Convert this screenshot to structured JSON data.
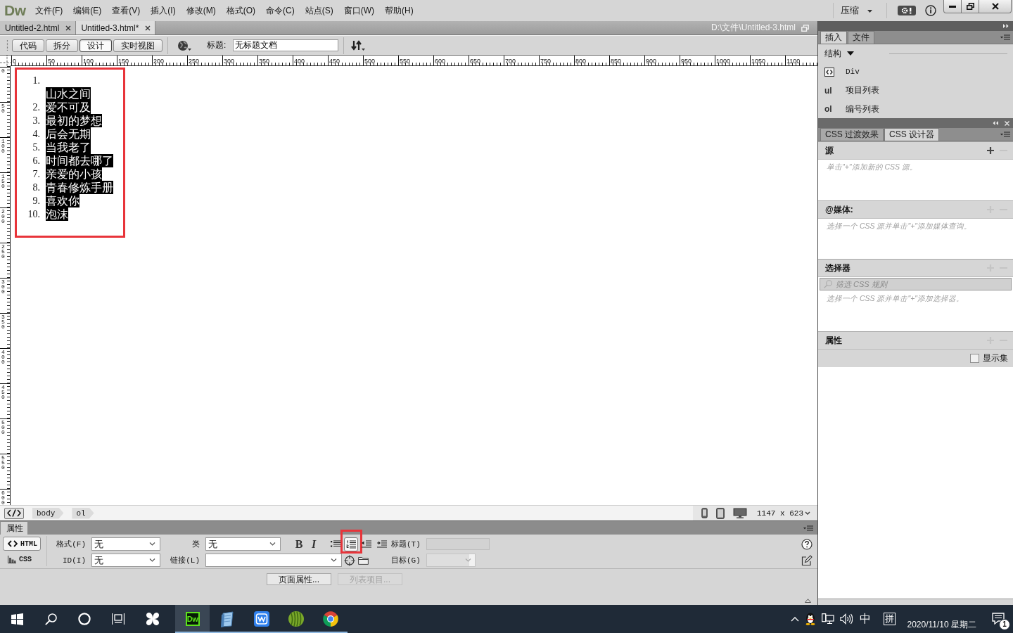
{
  "menu_bar": {
    "logo": "Dw",
    "menus": [
      "文件(F)",
      "编辑(E)",
      "查看(V)",
      "插入(I)",
      "修改(M)",
      "格式(O)",
      "命令(C)",
      "站点(S)",
      "窗口(W)",
      "帮助(H)"
    ],
    "workspace": "压缩"
  },
  "document_tabs": [
    {
      "label": "Untitled-2.html",
      "selected": false
    },
    {
      "label": "Untitled-3.html*",
      "selected": true
    }
  ],
  "file_path": "D:\\文件\\Untitled-3.html",
  "document_toolbar": {
    "views": [
      {
        "label": "代码",
        "selected": false
      },
      {
        "label": "拆分",
        "selected": false
      },
      {
        "label": "设计",
        "selected": true
      },
      {
        "label": "实时视图",
        "selected": false
      }
    ],
    "title_label": "标题:",
    "title_value": "无标题文档"
  },
  "rulers": {
    "horizontal": [
      "0",
      "50",
      "100",
      "150",
      "200",
      "250",
      "300",
      "350",
      "400",
      "450",
      "500",
      "550",
      "600",
      "650",
      "700",
      "750",
      "800",
      "850",
      "900",
      "950",
      "1000",
      "1050",
      "1100"
    ],
    "vertical": [
      "0",
      "50",
      "100",
      "150",
      "200",
      "250",
      "300",
      "350",
      "400",
      "450",
      "500",
      "550",
      "600"
    ]
  },
  "design_view": {
    "list_selected": true,
    "highlight_frame": true,
    "items": [
      {
        "number": "1.",
        "text": "山水之间",
        "break_before": true
      },
      {
        "number": "2.",
        "text": "爱不可及",
        "break_before": false
      },
      {
        "number": "3.",
        "text": "最初的梦想",
        "break_before": false
      },
      {
        "number": "4.",
        "text": "后会无期",
        "break_before": false
      },
      {
        "number": "5.",
        "text": "当我老了",
        "break_before": false
      },
      {
        "number": "6.",
        "text": "时间都去哪了",
        "break_before": false
      },
      {
        "number": "7.",
        "text": "亲爱的小孩",
        "break_before": false
      },
      {
        "number": "8.",
        "text": "青春修炼手册",
        "break_before": false
      },
      {
        "number": "9.",
        "text": "喜欢你",
        "break_before": false
      },
      {
        "number": "10.",
        "text": "泡沫",
        "break_before": false
      }
    ]
  },
  "status_bar": {
    "tags": [
      "body",
      "ol"
    ],
    "window_size": "1147 x 623"
  },
  "properties": {
    "title": "属性",
    "modes": [
      {
        "label": "HTML",
        "selected": true
      },
      {
        "label": "CSS",
        "selected": false
      }
    ],
    "format": {
      "label": "格式(F)",
      "value": "无"
    },
    "id": {
      "label": "ID(I)",
      "value": "无"
    },
    "class": {
      "label": "类",
      "value": "无"
    },
    "link": {
      "label": "链接(L)"
    },
    "bold": "B",
    "italic": "I",
    "list_buttons": [
      {
        "kind": "unordered",
        "pressed": false,
        "highlighted": false
      },
      {
        "kind": "ordered",
        "pressed": true,
        "highlighted": true
      },
      {
        "kind": "outdent",
        "pressed": false,
        "highlighted": false
      },
      {
        "kind": "indent",
        "pressed": false,
        "highlighted": false
      }
    ],
    "heading": {
      "label": "标题(T)",
      "disabled": true
    },
    "target": {
      "label": "目标(G)",
      "disabled": true
    },
    "buttons": [
      {
        "label": "页面属性...",
        "disabled": false
      },
      {
        "label": "列表项目...",
        "disabled": true
      }
    ]
  },
  "insert_panel": {
    "tabs": [
      {
        "label": "插入",
        "selected": true
      },
      {
        "label": "文件",
        "selected": false
      }
    ],
    "category": "结构",
    "items": [
      {
        "kind": "icon",
        "label": "Div"
      },
      {
        "kind": "badge",
        "badge": "ul",
        "label": "项目列表"
      },
      {
        "kind": "badge",
        "badge": "ol",
        "label": "编号列表"
      }
    ]
  },
  "css_panel": {
    "tabs": [
      {
        "label": "CSS 过渡效果",
        "selected": false
      },
      {
        "label": "CSS 设计器",
        "selected": true
      }
    ],
    "sections": [
      {
        "kind": "list",
        "title": "源",
        "add_enabled": true,
        "hint": "单击\"+\"添加新的 CSS 源。"
      },
      {
        "kind": "list",
        "title": "@媒体:",
        "add_enabled": false,
        "hint": "选择一个 CSS 源并单击\"+\"添加媒体查询。"
      },
      {
        "kind": "filter",
        "title": "选择器",
        "add_enabled": false,
        "placeholder": "筛选 CSS 规则",
        "hint": "选择一个 CSS 源并单击\"+\"添加选择器。"
      },
      {
        "kind": "properties",
        "title": "属性",
        "add_enabled": false,
        "option": "显示集",
        "checked": false
      }
    ]
  },
  "taskbar": {
    "system_buttons": [
      {
        "kind": "start"
      },
      {
        "kind": "search"
      },
      {
        "kind": "cortana"
      },
      {
        "kind": "task_view"
      }
    ],
    "apps": [
      {
        "kind": "pinwheel",
        "running": false,
        "active": false
      },
      {
        "kind": "dw",
        "label": "Dw",
        "running": true,
        "active": true
      },
      {
        "kind": "notepad",
        "running": true,
        "active": false
      },
      {
        "kind": "wps",
        "running": true,
        "active": false
      },
      {
        "kind": "melon",
        "running": true,
        "active": false
      },
      {
        "kind": "chrome",
        "running": true,
        "active": false
      }
    ],
    "ime": "中",
    "ime_mode": "拼",
    "date": "2020/11/10 星期二",
    "notification_count": "1"
  }
}
